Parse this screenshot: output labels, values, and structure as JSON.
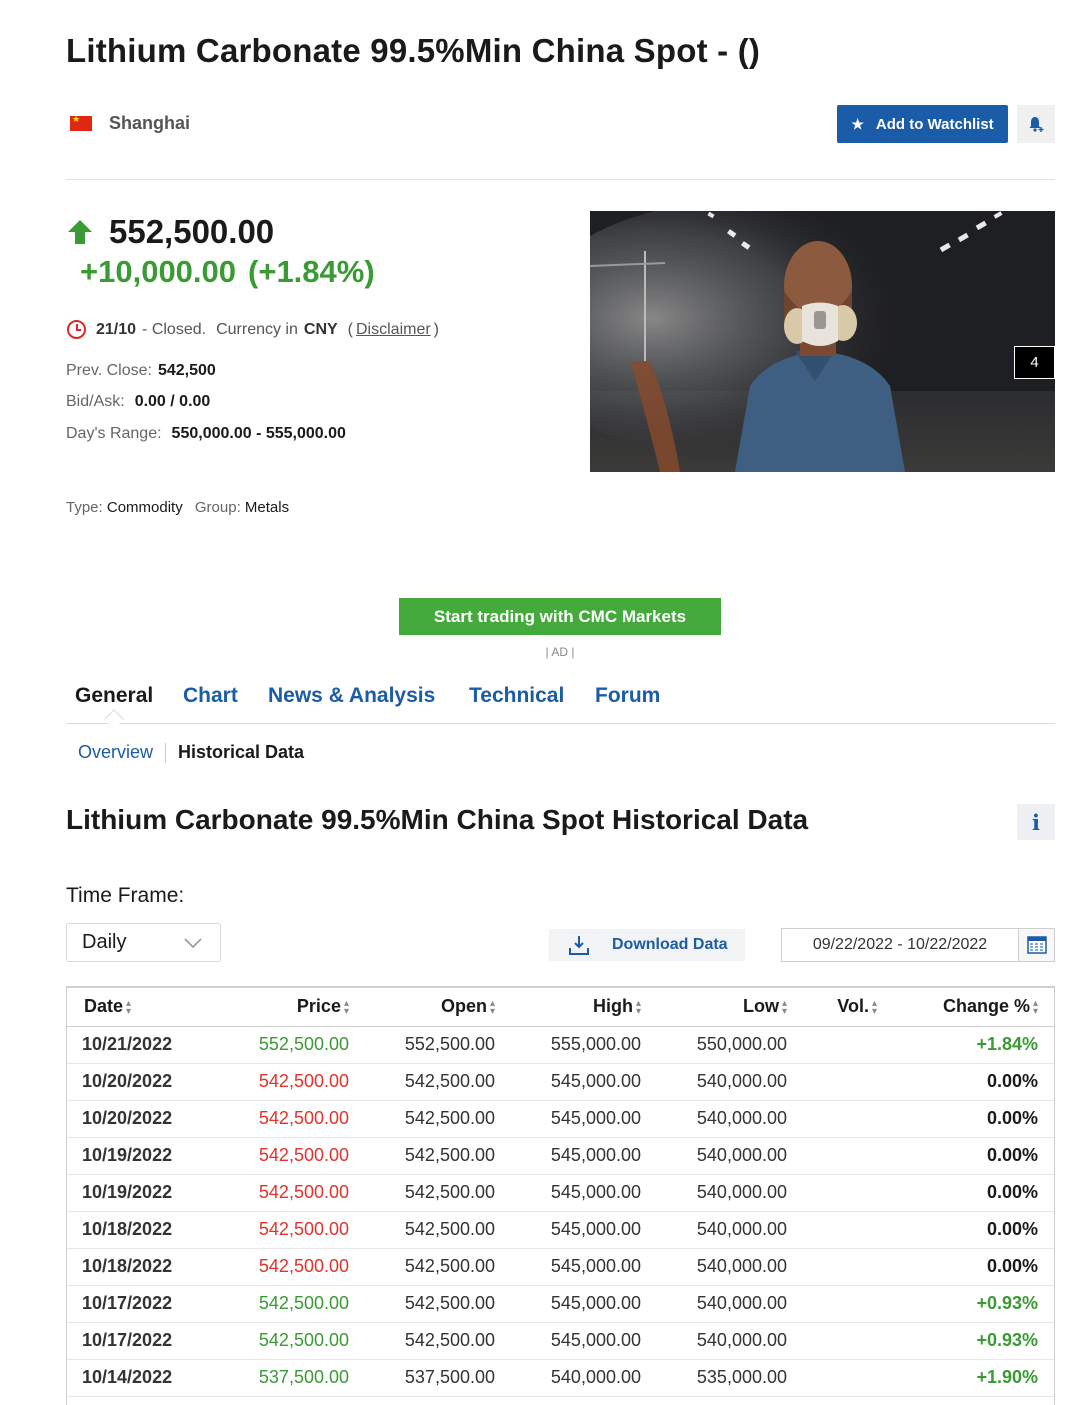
{
  "header": {
    "title": "Lithium Carbonate 99.5%Min China Spot - ()",
    "exchange": "Shanghai",
    "watchlist_label": "Add to Watchlist"
  },
  "quote": {
    "last": "552,500.00",
    "change": "+10,000.00",
    "change_pct": "(+1.84%)",
    "status_date": "21/10",
    "status_text": "- Closed.",
    "currency_label": "Currency in",
    "currency": "CNY",
    "disclaimer": "Disclaimer",
    "prev_close_label": "Prev. Close:",
    "prev_close": "542,500",
    "bid_ask_label": "Bid/Ask:",
    "bid_ask": "0.00 / 0.00",
    "day_range_label": "Day's Range:",
    "day_range": "550,000.00 - 555,000.00",
    "type_label": "Type:",
    "type": "Commodity",
    "group_label": "Group:",
    "group": "Metals"
  },
  "ad": {
    "badge": "4",
    "cta_label": "Start trading with CMC Markets",
    "ad_label": "| AD |"
  },
  "nav": {
    "tabs": [
      {
        "label": "General"
      },
      {
        "label": "Chart"
      },
      {
        "label": "News & Analysis"
      },
      {
        "label": "Technical"
      },
      {
        "label": "Forum"
      }
    ],
    "subtabs": {
      "overview": "Overview",
      "historical": "Historical Data"
    }
  },
  "historical": {
    "title": "Lithium Carbonate 99.5%Min China Spot Historical Data",
    "info_icon": "i",
    "timeframe_label": "Time Frame:",
    "timeframe_value": "Daily",
    "download_label": "Download Data",
    "date_range": "09/22/2022 - 10/22/2022",
    "columns": {
      "date": "Date",
      "price": "Price",
      "open": "Open",
      "high": "High",
      "low": "Low",
      "vol": "Vol.",
      "change": "Change %"
    },
    "rows": [
      {
        "date": "10/21/2022",
        "price": "552,500.00",
        "open": "552,500.00",
        "high": "555,000.00",
        "low": "550,000.00",
        "vol": "",
        "change": "+1.84%",
        "dir": "pos"
      },
      {
        "date": "10/20/2022",
        "price": "542,500.00",
        "open": "542,500.00",
        "high": "545,000.00",
        "low": "540,000.00",
        "vol": "",
        "change": "0.00%",
        "dir": "neg"
      },
      {
        "date": "10/20/2022",
        "price": "542,500.00",
        "open": "542,500.00",
        "high": "545,000.00",
        "low": "540,000.00",
        "vol": "",
        "change": "0.00%",
        "dir": "neg"
      },
      {
        "date": "10/19/2022",
        "price": "542,500.00",
        "open": "542,500.00",
        "high": "545,000.00",
        "low": "540,000.00",
        "vol": "",
        "change": "0.00%",
        "dir": "neg"
      },
      {
        "date": "10/19/2022",
        "price": "542,500.00",
        "open": "542,500.00",
        "high": "545,000.00",
        "low": "540,000.00",
        "vol": "",
        "change": "0.00%",
        "dir": "neg"
      },
      {
        "date": "10/18/2022",
        "price": "542,500.00",
        "open": "542,500.00",
        "high": "545,000.00",
        "low": "540,000.00",
        "vol": "",
        "change": "0.00%",
        "dir": "neg"
      },
      {
        "date": "10/18/2022",
        "price": "542,500.00",
        "open": "542,500.00",
        "high": "545,000.00",
        "low": "540,000.00",
        "vol": "",
        "change": "0.00%",
        "dir": "neg"
      },
      {
        "date": "10/17/2022",
        "price": "542,500.00",
        "open": "542,500.00",
        "high": "545,000.00",
        "low": "540,000.00",
        "vol": "",
        "change": "+0.93%",
        "dir": "pos"
      },
      {
        "date": "10/17/2022",
        "price": "542,500.00",
        "open": "542,500.00",
        "high": "545,000.00",
        "low": "540,000.00",
        "vol": "",
        "change": "+0.93%",
        "dir": "pos"
      },
      {
        "date": "10/14/2022",
        "price": "537,500.00",
        "open": "537,500.00",
        "high": "540,000.00",
        "low": "535,000.00",
        "vol": "",
        "change": "+1.90%",
        "dir": "pos"
      }
    ]
  },
  "colors": {
    "brand_blue": "#1b5ca8",
    "positive": "#3a9a33",
    "negative": "#e2332a",
    "cta_green": "#44aa3c"
  },
  "icons": [
    "china-flag-icon",
    "star-icon",
    "bell-plus-icon",
    "up-arrow-icon",
    "clock-icon",
    "info-icon",
    "chevron-down-icon",
    "download-icon",
    "calendar-icon",
    "sort-icon"
  ]
}
